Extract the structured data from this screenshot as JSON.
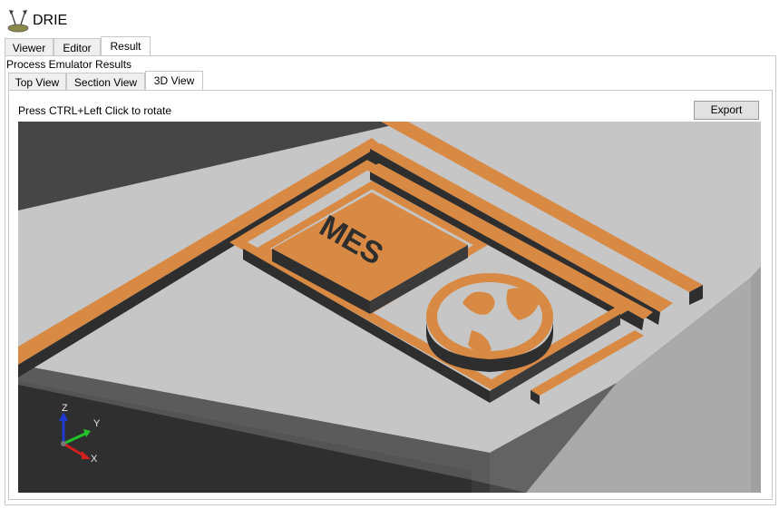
{
  "app": {
    "title": "DRIE",
    "icon": "drie-app-icon"
  },
  "main_tabs": [
    {
      "label": "Viewer"
    },
    {
      "label": "Editor"
    },
    {
      "label": "Result"
    }
  ],
  "section": {
    "label": "Process Emulator Results"
  },
  "sub_tabs": [
    {
      "label": "Top View"
    },
    {
      "label": "Section View"
    },
    {
      "label": "3D View"
    }
  ],
  "view3d": {
    "hint": "Press CTRL+Left Click to rotate",
    "export_label": "Export",
    "axes": {
      "z": "Z",
      "y": "Y",
      "x": "X"
    },
    "colors": {
      "background": "#464646",
      "substrate": "#c8c8c8",
      "mask": "#d88a44",
      "sidewall": "#2e2e2e"
    }
  }
}
